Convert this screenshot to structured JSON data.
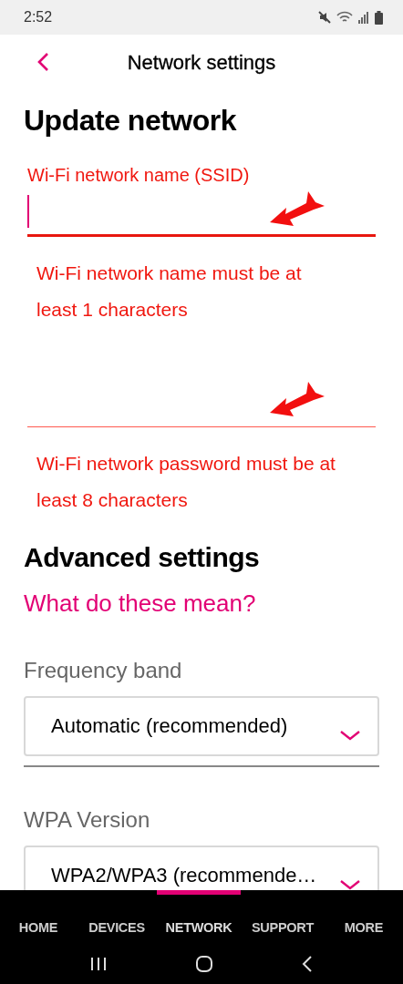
{
  "status_bar": {
    "time": "2:52"
  },
  "header": {
    "title": "Network settings"
  },
  "heading": "Update network",
  "fields": [
    {
      "label": "Wi-Fi network name (SSID)",
      "focused": true,
      "error": "Wi-Fi network name must be at least 1 characters"
    },
    {
      "focused": false,
      "error": "Wi-Fi network password must be at least 8 characters"
    }
  ],
  "advanced": {
    "heading": "Advanced settings",
    "link": "What do these mean?",
    "selects": [
      {
        "label": "Frequency band",
        "value": "Automatic (recommended)"
      },
      {
        "label": "WPA Version",
        "value": "WPA2/WPA3 (recommende…"
      }
    ]
  },
  "nav": {
    "tabs": [
      {
        "label": "HOME",
        "selected": false
      },
      {
        "label": "DEVICES",
        "selected": false
      },
      {
        "label": "NETWORK",
        "selected": true
      },
      {
        "label": "SUPPORT",
        "selected": false
      },
      {
        "label": "MORE",
        "selected": false
      }
    ]
  }
}
